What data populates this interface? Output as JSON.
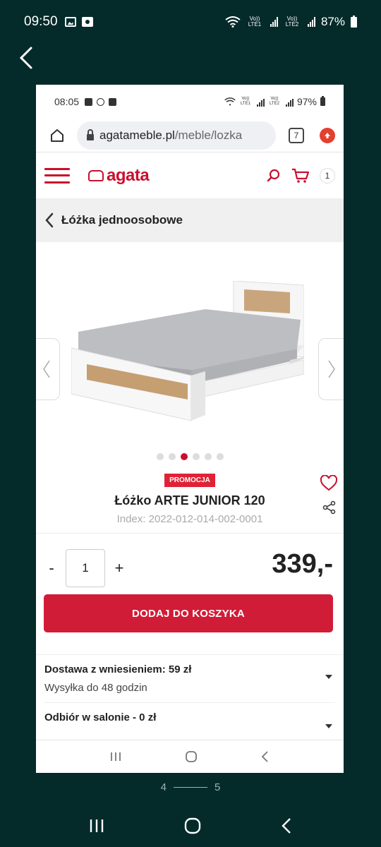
{
  "outer_status": {
    "time": "09:50",
    "network1": "Vo)) LTE1",
    "network2": "Vo)) LTE2",
    "battery": "87%"
  },
  "inner_status": {
    "time": "08:05",
    "network1": "Vo)) LTE1",
    "network2": "Vo)) LTE2",
    "battery": "97%"
  },
  "browser": {
    "url_host": "agatameble.pl",
    "url_path": "/meble/lozka",
    "tab_count": "7"
  },
  "site": {
    "logo": "agata",
    "cart_count": "1"
  },
  "breadcrumb": {
    "label": "Łóżka jednoosobowe"
  },
  "gallery": {
    "total": 6,
    "active_index": 2
  },
  "product": {
    "badge": "PROMOCJA",
    "title": "Łóżko ARTE JUNIOR 120",
    "index": "Index: 2022-012-014-002-0001",
    "quantity": "1",
    "minus": "-",
    "plus": "+",
    "price": "339,-",
    "add_to_cart": "DODAJ DO KOSZYKA"
  },
  "shipping": [
    {
      "title": "Dostawa z wniesieniem: 59 zł",
      "subtitle": "Wysyłka do 48 godzin"
    },
    {
      "title": "Odbiór w salonie - 0 zł"
    }
  ],
  "pager": {
    "current": "4",
    "total": "5"
  },
  "colors": {
    "brand": "#c8102e",
    "button": "#d11c37",
    "outer_bg": "#042a2a"
  }
}
